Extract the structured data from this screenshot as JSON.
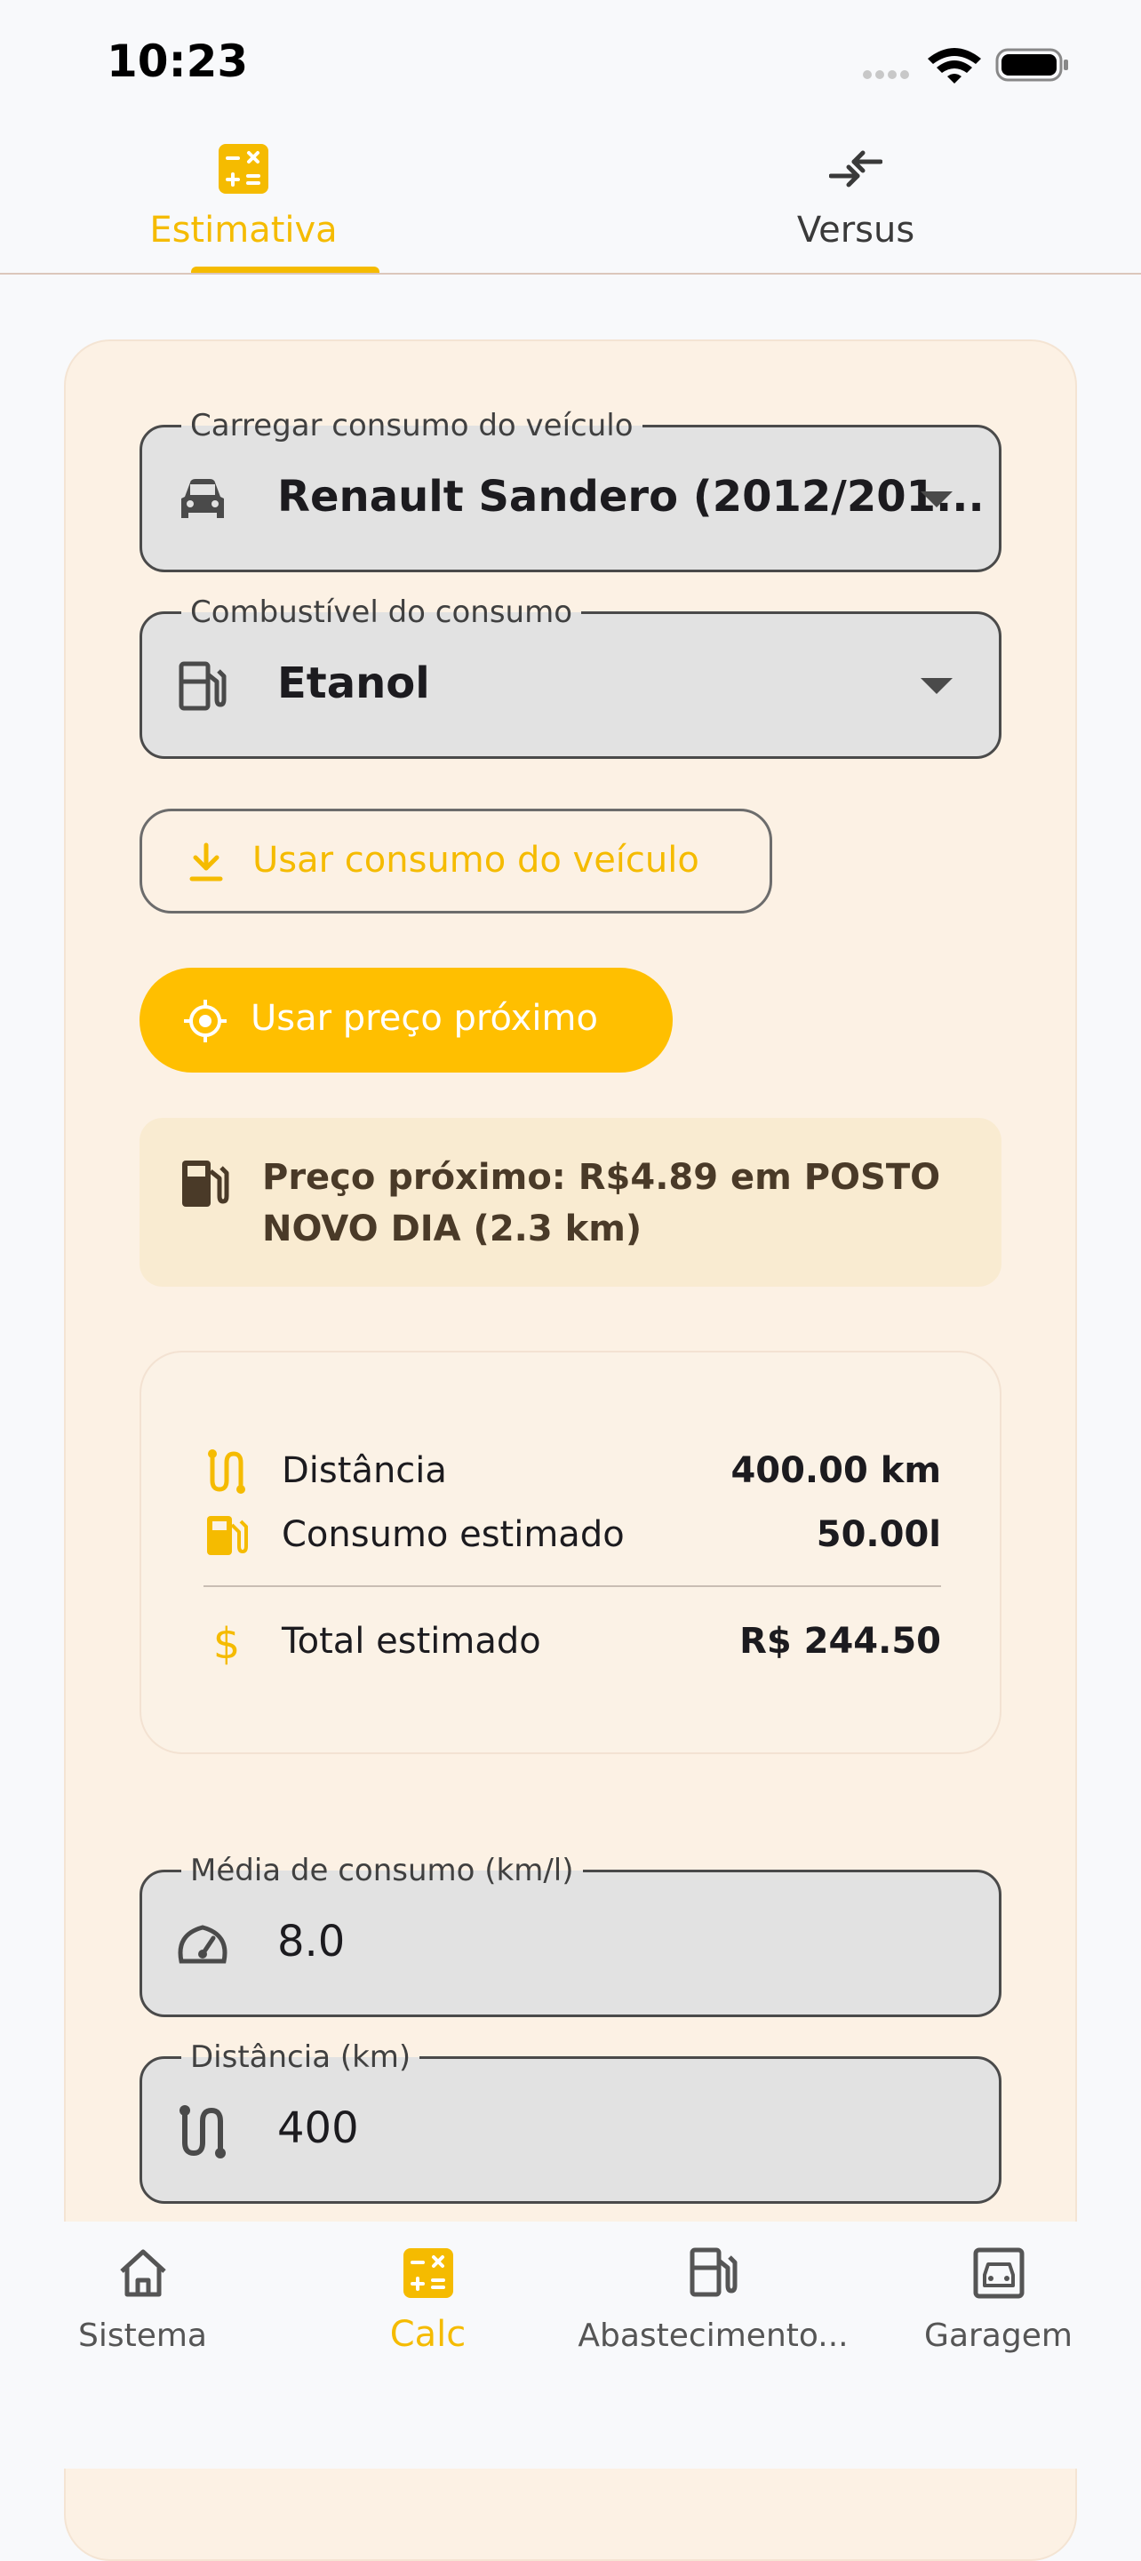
{
  "status_bar": {
    "time": "10:23"
  },
  "tabs": [
    {
      "label": "Estimativa",
      "icon": "calculator-icon",
      "active": true
    },
    {
      "label": "Versus",
      "icon": "compare-arrows-icon",
      "active": false
    }
  ],
  "vehicle_field": {
    "label": "Carregar consumo do veículo",
    "value": "Renault Sandero (2012/201...",
    "icon": "car-icon"
  },
  "fuel_field": {
    "label": "Combustível do consumo",
    "value": "Etanol",
    "icon": "fuel-pump-icon"
  },
  "buttons": {
    "use_vehicle": "Usar consumo do veículo",
    "near_price": "Usar preço próximo"
  },
  "near_price_info": "Preço próximo: R$4.89 em POSTO NOVO DIA (2.3 km)",
  "summary": {
    "distance_label": "Distância",
    "distance_value": "400.00 km",
    "consumption_label": "Consumo estimado",
    "consumption_value": "50.00l",
    "total_label": "Total estimado",
    "total_value": "R$ 244.50"
  },
  "avg_field": {
    "label": "Média de consumo (km/l)",
    "value": "8.0",
    "icon": "speedometer-icon"
  },
  "distance_field": {
    "label": "Distância (km)",
    "value": "400",
    "icon": "route-icon"
  },
  "bottom_nav": [
    {
      "label": "Sistema",
      "icon": "home-icon",
      "active": false
    },
    {
      "label": "Calc",
      "icon": "calculator-icon",
      "active": true
    },
    {
      "label": "Abastecimento...",
      "icon": "fuel-pump-icon",
      "active": false
    },
    {
      "label": "Garagem",
      "icon": "garage-icon",
      "active": false
    }
  ],
  "colors": {
    "accent": "#f5bb00",
    "card_bg": "#fcf1e4",
    "field_bg": "#e2e2e2"
  }
}
